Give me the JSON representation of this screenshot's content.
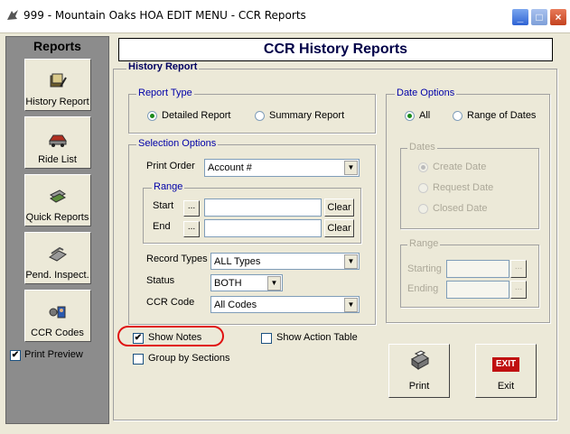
{
  "window": {
    "title": "999 - Mountain Oaks HOA EDIT MENU - CCR Reports",
    "app_icon": "app-icon",
    "min_glyph": "_",
    "max_glyph": "□",
    "close_glyph": "×"
  },
  "sidebar": {
    "title": "Reports",
    "items": [
      {
        "label": "History Report",
        "icon": "history-report-icon"
      },
      {
        "label": "Ride List",
        "icon": "ride-list-icon"
      },
      {
        "label": "Quick Reports",
        "icon": "quick-reports-icon"
      },
      {
        "label": "Pend. Inspect.",
        "icon": "pending-inspection-icon"
      },
      {
        "label": "CCR Codes",
        "icon": "ccr-codes-icon"
      }
    ],
    "print_preview": {
      "label": "Print Preview",
      "checked": true
    }
  },
  "header": {
    "title": "CCR History Reports"
  },
  "history_report": {
    "legend": "History Report",
    "report_type": {
      "legend": "Report Type",
      "options": [
        "Detailed Report",
        "Summary Report"
      ],
      "selected": "Detailed Report"
    },
    "selection_options": {
      "legend": "Selection Options",
      "print_order_label": "Print Order",
      "print_order_value": "Account #",
      "range": {
        "legend": "Range",
        "start_label": "Start",
        "end_label": "End",
        "browse_label": "...",
        "clear_label": "Clear",
        "start_value": "",
        "end_value": ""
      },
      "record_types_label": "Record Types",
      "record_types_value": "ALL Types",
      "status_label": "Status",
      "status_value": "BOTH",
      "ccr_code_label": "CCR Code",
      "ccr_code_value": "All Codes"
    },
    "date_options": {
      "legend": "Date Options",
      "options": [
        "All",
        "Range of Dates"
      ],
      "selected": "All",
      "dates": {
        "legend": "Dates",
        "options": [
          "Create Date",
          "Request Date",
          "Closed Date"
        ],
        "selected": "Create Date"
      },
      "range": {
        "legend": "Range",
        "starting_label": "Starting",
        "ending_label": "Ending",
        "browse_label": "..."
      }
    },
    "show_notes": {
      "label": "Show Notes",
      "checked": true
    },
    "show_action_table": {
      "label": "Show Action Table",
      "checked": false
    },
    "group_by_sections": {
      "label": "Group by Sections",
      "checked": false
    }
  },
  "actions": {
    "print_label": "Print",
    "exit_label": "Exit",
    "exit_badge": "EXIT"
  },
  "colors": {
    "annotation": "#e01010",
    "title_navy": "#000048",
    "legend_blue": "#0000a8"
  }
}
